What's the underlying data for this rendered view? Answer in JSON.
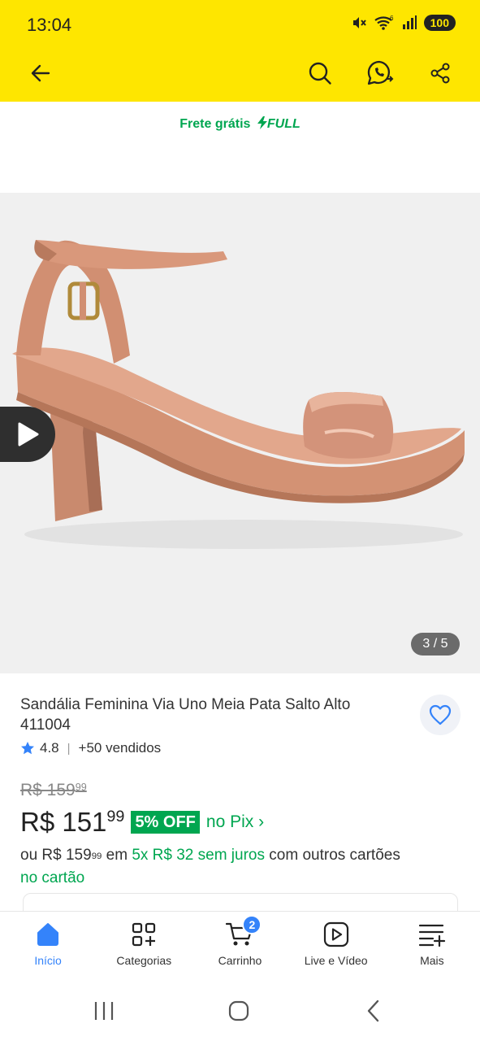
{
  "status": {
    "time": "13:04",
    "battery": "100",
    "net": "6"
  },
  "toolbar": {
    "back": "back-arrow-icon",
    "search": "search-icon",
    "whatsapp": "whatsapp-icon",
    "share": "share-icon"
  },
  "shipping": {
    "label": "Frete grátis",
    "full": "FULL"
  },
  "gallery": {
    "counter": "3 / 5",
    "product_image": "pink-patent-heeled-sandal"
  },
  "product": {
    "title": "Sandália Feminina Via Uno Meia Pata Salto Alto 411004",
    "rating": "4.8",
    "sold": "+50 vendidos",
    "old_price_main": "R$ 159",
    "old_price_cents": "99",
    "price_main": "R$ 151",
    "price_cents": "99",
    "discount": "5% OFF",
    "pix": "no Pix",
    "pix_arrow": "›",
    "inst_prefix": "ou R$ 159",
    "inst_cents": "99",
    "inst_em": " em ",
    "inst_green": "5x R$ 32 sem juros",
    "inst_suffix": " com outros cartões",
    "inst_line2": "no cartão"
  },
  "nav": {
    "items": [
      {
        "label": "Início",
        "icon": "home-icon"
      },
      {
        "label": "Categorias",
        "icon": "categories-icon"
      },
      {
        "label": "Carrinho",
        "icon": "cart-icon",
        "badge": "2"
      },
      {
        "label": "Live e Vídeo",
        "icon": "video-icon"
      },
      {
        "label": "Mais",
        "icon": "menu-plus-icon"
      }
    ]
  },
  "colors": {
    "brand_yellow": "#fee600",
    "accent_blue": "#3483fa",
    "green": "#00a650"
  }
}
